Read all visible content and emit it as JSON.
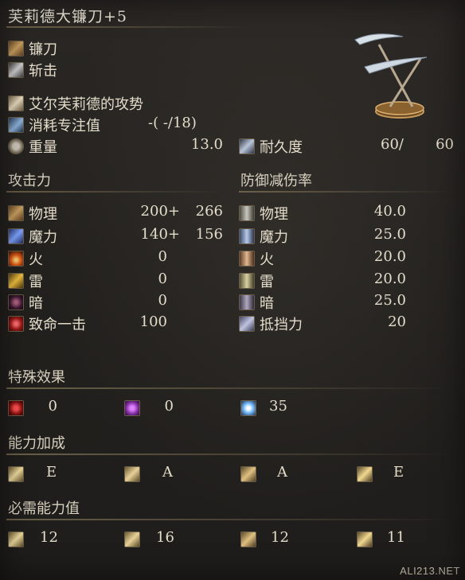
{
  "title": "芙莉德大镰刀+5",
  "info": {
    "weapon_type": "镰刀",
    "attack_type": "斩击",
    "skill": "艾尔芙莉德的攻势",
    "fp_cost_label": "消耗专注值",
    "fp_cost_value": "-(  -/18)",
    "weight_label": "重量",
    "weight_value": "13.0",
    "durability_label": "耐久度",
    "durability_current": "60/",
    "durability_max": "60"
  },
  "attack": {
    "header": "攻击力",
    "rows": [
      {
        "icon": "physical-attack-icon",
        "label": "物理",
        "base": "200+",
        "total": "266"
      },
      {
        "icon": "magic-attack-icon",
        "label": "魔力",
        "base": "140+",
        "total": "156"
      },
      {
        "icon": "fire-attack-icon",
        "label": "火",
        "base": "0",
        "total": ""
      },
      {
        "icon": "lightning-attack-icon",
        "label": "雷",
        "base": "0",
        "total": ""
      },
      {
        "icon": "dark-attack-icon",
        "label": "暗",
        "base": "0",
        "total": ""
      },
      {
        "icon": "critical-icon",
        "label": "致命一击",
        "base": "100",
        "total": ""
      }
    ]
  },
  "defense": {
    "header": "防御减伤率",
    "rows": [
      {
        "icon": "physical-defense-icon",
        "label": "物理",
        "value": "40.0"
      },
      {
        "icon": "magic-defense-icon",
        "label": "魔力",
        "value": "25.0"
      },
      {
        "icon": "fire-defense-icon",
        "label": "火",
        "value": "20.0"
      },
      {
        "icon": "lightning-defense-icon",
        "label": "雷",
        "value": "20.0"
      },
      {
        "icon": "dark-defense-icon",
        "label": "暗",
        "value": "25.0"
      },
      {
        "icon": "stability-icon",
        "label": "抵挡力",
        "value": "20"
      }
    ]
  },
  "effects": {
    "header": "特殊效果",
    "items": [
      {
        "icon": "bleed-icon",
        "value": "0"
      },
      {
        "icon": "poison-icon",
        "value": "0"
      },
      {
        "icon": "frost-icon",
        "value": "35"
      }
    ]
  },
  "scaling": {
    "header": "能力加成",
    "items": [
      {
        "icon": "strength-icon",
        "value": "E"
      },
      {
        "icon": "dexterity-icon",
        "value": "A"
      },
      {
        "icon": "intelligence-icon",
        "value": "A"
      },
      {
        "icon": "faith-icon",
        "value": "E"
      }
    ]
  },
  "requirements": {
    "header": "必需能力值",
    "items": [
      {
        "icon": "strength-icon",
        "value": "12"
      },
      {
        "icon": "dexterity-icon",
        "value": "16"
      },
      {
        "icon": "intelligence-icon",
        "value": "12"
      },
      {
        "icon": "faith-icon",
        "value": "11"
      }
    ]
  },
  "watermark": "ALI213.NET"
}
